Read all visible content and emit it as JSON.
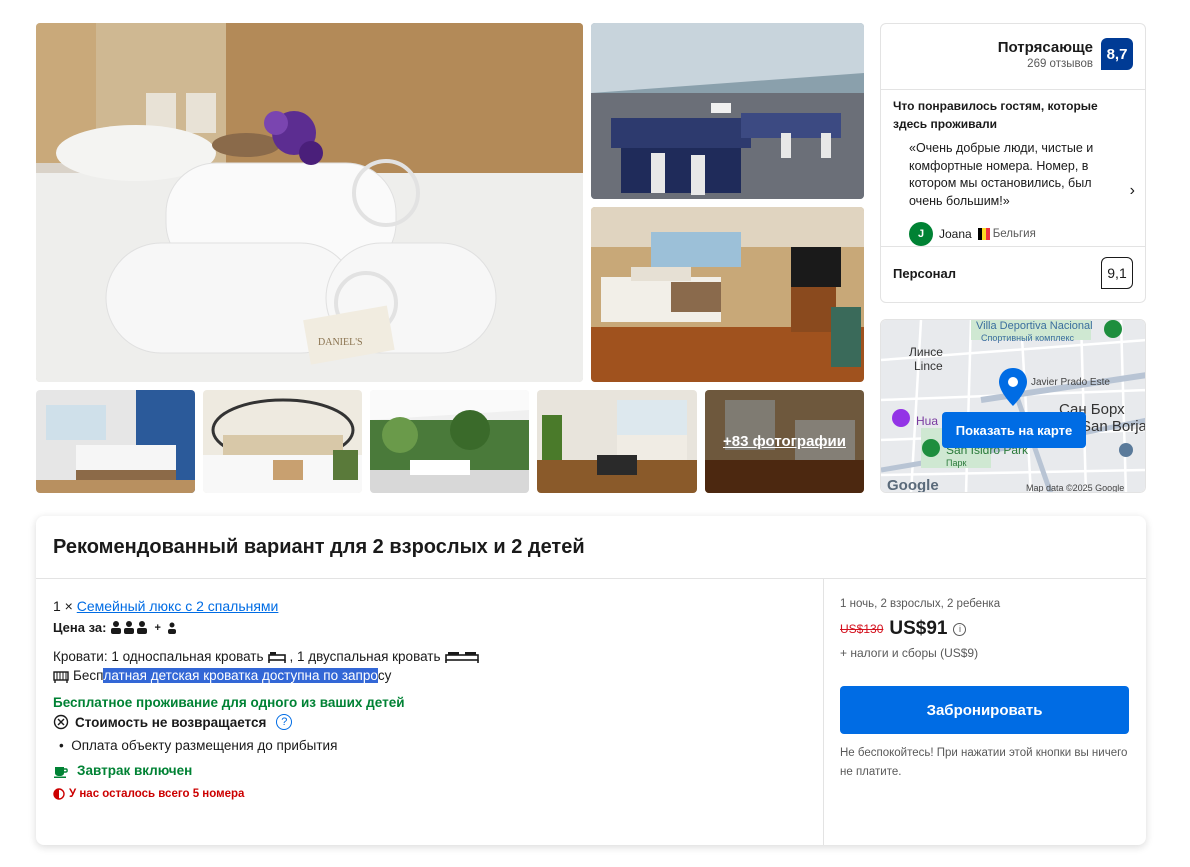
{
  "gallery": {
    "more_photos_label": "+83 фотографии",
    "photo_watermark": "DANIEL'S"
  },
  "review_summary": {
    "rating_word": "Потрясающе",
    "reviews_count": "269 отзывов",
    "score": "8,7",
    "liked_heading": "Что понравилось гостям, которые здесь проживали",
    "quote": "«Очень добрые люди, чистые и комфортные номера. Номер, в котором мы остановились, был очень большим!»",
    "reviewer_initial": "J",
    "reviewer_name": "Joana",
    "reviewer_country": "Бельгия",
    "category_label": "Персонал",
    "category_score": "9,1"
  },
  "map": {
    "button_label": "Показать на карте",
    "labels": {
      "villa": "Villa Deportiva Nacional",
      "sport": "Спортивный комплекс",
      "lince_ru": "Линсе",
      "lince": "Lince",
      "javier": "Javier Prado Este",
      "san_borja_ru": "Сан Борх",
      "san_borja": "San Borja",
      "huaca": "Hua",
      "park": "San Isidro Park",
      "park_ru": "Парк",
      "google": "Google",
      "attribution": "Map data ©2025 Google"
    }
  },
  "offer": {
    "title": "Рекомендованный вариант для 2 взрослых и 2 детей",
    "room_qty": "1 ×",
    "room_name": "Семейный люкс с 2 спальнями",
    "price_for_label": "Цена за:",
    "price_for_plus": "+",
    "beds_prefix": "Кровати: 1 односпальная кровать",
    "beds_middle": ", 1 двуспальная кровать",
    "crib_before": "Бесп",
    "crib_highlight": "латная детская кроватка доступна по запро",
    "crib_after": "су",
    "free_kids": "Бесплатное проживание для одного из ваших детей",
    "non_refundable": "Стоимость не возвращается",
    "payment_bullet": "Оплата объекту размещения до прибытия",
    "breakfast": "Завтрак включен",
    "scarcity": "У нас осталось всего 5 номера"
  },
  "price_panel": {
    "stay_info": "1 ночь, 2 взрослых, 2 ребенка",
    "old_price": "US$130",
    "new_price": "US$91",
    "info_icon": "i",
    "taxes": "+ налоги и сборы (US$9)",
    "book_button": "Забронировать",
    "note": "Не беспокойтесь! При нажатии этой кнопки вы ничего не платите."
  },
  "colors": {
    "brand_blue": "#003b95",
    "action_blue": "#006ce4",
    "green": "#008234",
    "red": "#d4111e"
  }
}
